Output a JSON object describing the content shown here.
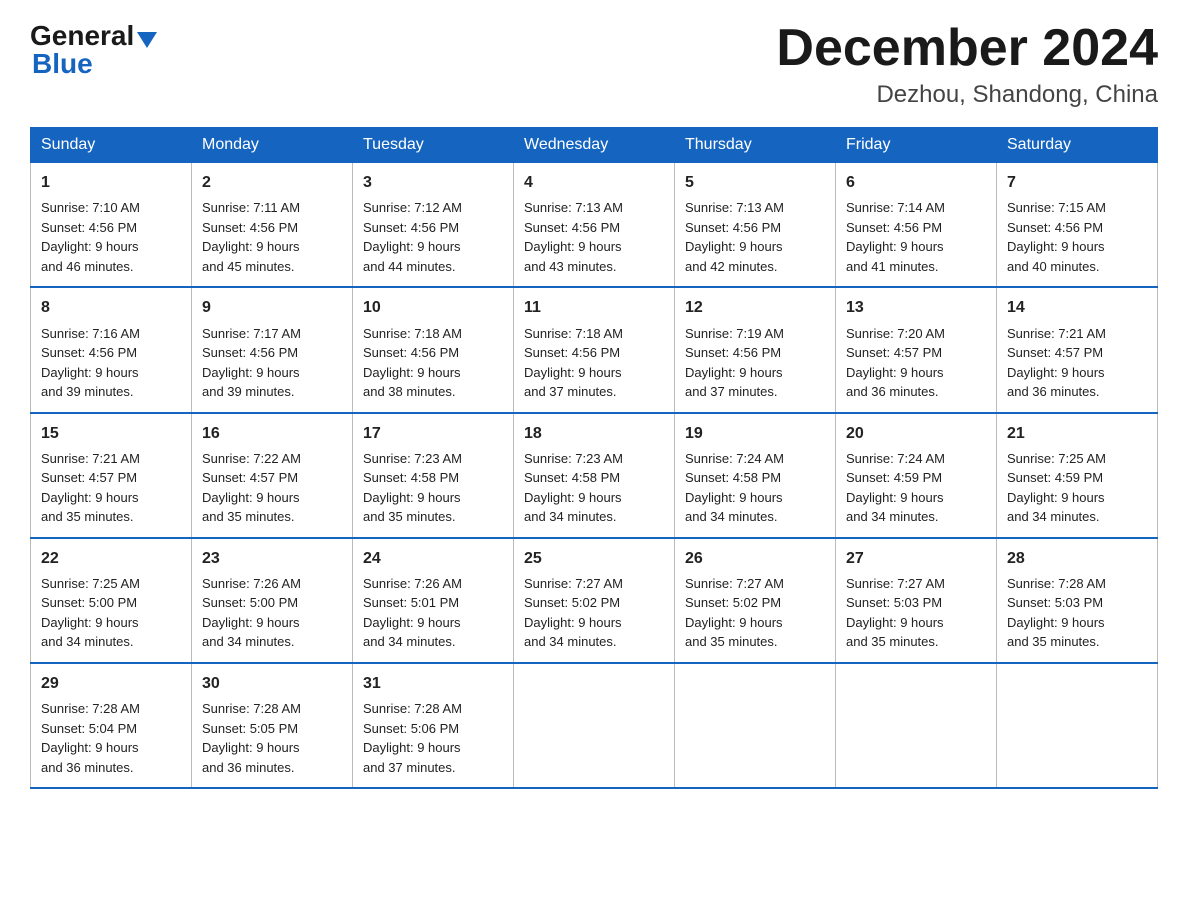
{
  "logo": {
    "line1": "General",
    "triangle": "▶",
    "line2": "Blue"
  },
  "header": {
    "title": "December 2024",
    "location": "Dezhou, Shandong, China"
  },
  "weekdays": [
    "Sunday",
    "Monday",
    "Tuesday",
    "Wednesday",
    "Thursday",
    "Friday",
    "Saturday"
  ],
  "weeks": [
    [
      {
        "day": "1",
        "sunrise": "7:10 AM",
        "sunset": "4:56 PM",
        "daylight": "9 hours and 46 minutes."
      },
      {
        "day": "2",
        "sunrise": "7:11 AM",
        "sunset": "4:56 PM",
        "daylight": "9 hours and 45 minutes."
      },
      {
        "day": "3",
        "sunrise": "7:12 AM",
        "sunset": "4:56 PM",
        "daylight": "9 hours and 44 minutes."
      },
      {
        "day": "4",
        "sunrise": "7:13 AM",
        "sunset": "4:56 PM",
        "daylight": "9 hours and 43 minutes."
      },
      {
        "day": "5",
        "sunrise": "7:13 AM",
        "sunset": "4:56 PM",
        "daylight": "9 hours and 42 minutes."
      },
      {
        "day": "6",
        "sunrise": "7:14 AM",
        "sunset": "4:56 PM",
        "daylight": "9 hours and 41 minutes."
      },
      {
        "day": "7",
        "sunrise": "7:15 AM",
        "sunset": "4:56 PM",
        "daylight": "9 hours and 40 minutes."
      }
    ],
    [
      {
        "day": "8",
        "sunrise": "7:16 AM",
        "sunset": "4:56 PM",
        "daylight": "9 hours and 39 minutes."
      },
      {
        "day": "9",
        "sunrise": "7:17 AM",
        "sunset": "4:56 PM",
        "daylight": "9 hours and 39 minutes."
      },
      {
        "day": "10",
        "sunrise": "7:18 AM",
        "sunset": "4:56 PM",
        "daylight": "9 hours and 38 minutes."
      },
      {
        "day": "11",
        "sunrise": "7:18 AM",
        "sunset": "4:56 PM",
        "daylight": "9 hours and 37 minutes."
      },
      {
        "day": "12",
        "sunrise": "7:19 AM",
        "sunset": "4:56 PM",
        "daylight": "9 hours and 37 minutes."
      },
      {
        "day": "13",
        "sunrise": "7:20 AM",
        "sunset": "4:57 PM",
        "daylight": "9 hours and 36 minutes."
      },
      {
        "day": "14",
        "sunrise": "7:21 AM",
        "sunset": "4:57 PM",
        "daylight": "9 hours and 36 minutes."
      }
    ],
    [
      {
        "day": "15",
        "sunrise": "7:21 AM",
        "sunset": "4:57 PM",
        "daylight": "9 hours and 35 minutes."
      },
      {
        "day": "16",
        "sunrise": "7:22 AM",
        "sunset": "4:57 PM",
        "daylight": "9 hours and 35 minutes."
      },
      {
        "day": "17",
        "sunrise": "7:23 AM",
        "sunset": "4:58 PM",
        "daylight": "9 hours and 35 minutes."
      },
      {
        "day": "18",
        "sunrise": "7:23 AM",
        "sunset": "4:58 PM",
        "daylight": "9 hours and 34 minutes."
      },
      {
        "day": "19",
        "sunrise": "7:24 AM",
        "sunset": "4:58 PM",
        "daylight": "9 hours and 34 minutes."
      },
      {
        "day": "20",
        "sunrise": "7:24 AM",
        "sunset": "4:59 PM",
        "daylight": "9 hours and 34 minutes."
      },
      {
        "day": "21",
        "sunrise": "7:25 AM",
        "sunset": "4:59 PM",
        "daylight": "9 hours and 34 minutes."
      }
    ],
    [
      {
        "day": "22",
        "sunrise": "7:25 AM",
        "sunset": "5:00 PM",
        "daylight": "9 hours and 34 minutes."
      },
      {
        "day": "23",
        "sunrise": "7:26 AM",
        "sunset": "5:00 PM",
        "daylight": "9 hours and 34 minutes."
      },
      {
        "day": "24",
        "sunrise": "7:26 AM",
        "sunset": "5:01 PM",
        "daylight": "9 hours and 34 minutes."
      },
      {
        "day": "25",
        "sunrise": "7:27 AM",
        "sunset": "5:02 PM",
        "daylight": "9 hours and 34 minutes."
      },
      {
        "day": "26",
        "sunrise": "7:27 AM",
        "sunset": "5:02 PM",
        "daylight": "9 hours and 35 minutes."
      },
      {
        "day": "27",
        "sunrise": "7:27 AM",
        "sunset": "5:03 PM",
        "daylight": "9 hours and 35 minutes."
      },
      {
        "day": "28",
        "sunrise": "7:28 AM",
        "sunset": "5:03 PM",
        "daylight": "9 hours and 35 minutes."
      }
    ],
    [
      {
        "day": "29",
        "sunrise": "7:28 AM",
        "sunset": "5:04 PM",
        "daylight": "9 hours and 36 minutes."
      },
      {
        "day": "30",
        "sunrise": "7:28 AM",
        "sunset": "5:05 PM",
        "daylight": "9 hours and 36 minutes."
      },
      {
        "day": "31",
        "sunrise": "7:28 AM",
        "sunset": "5:06 PM",
        "daylight": "9 hours and 37 minutes."
      },
      null,
      null,
      null,
      null
    ]
  ],
  "labels": {
    "sunrise_prefix": "Sunrise: ",
    "sunset_prefix": "Sunset: ",
    "daylight_prefix": "Daylight: "
  }
}
